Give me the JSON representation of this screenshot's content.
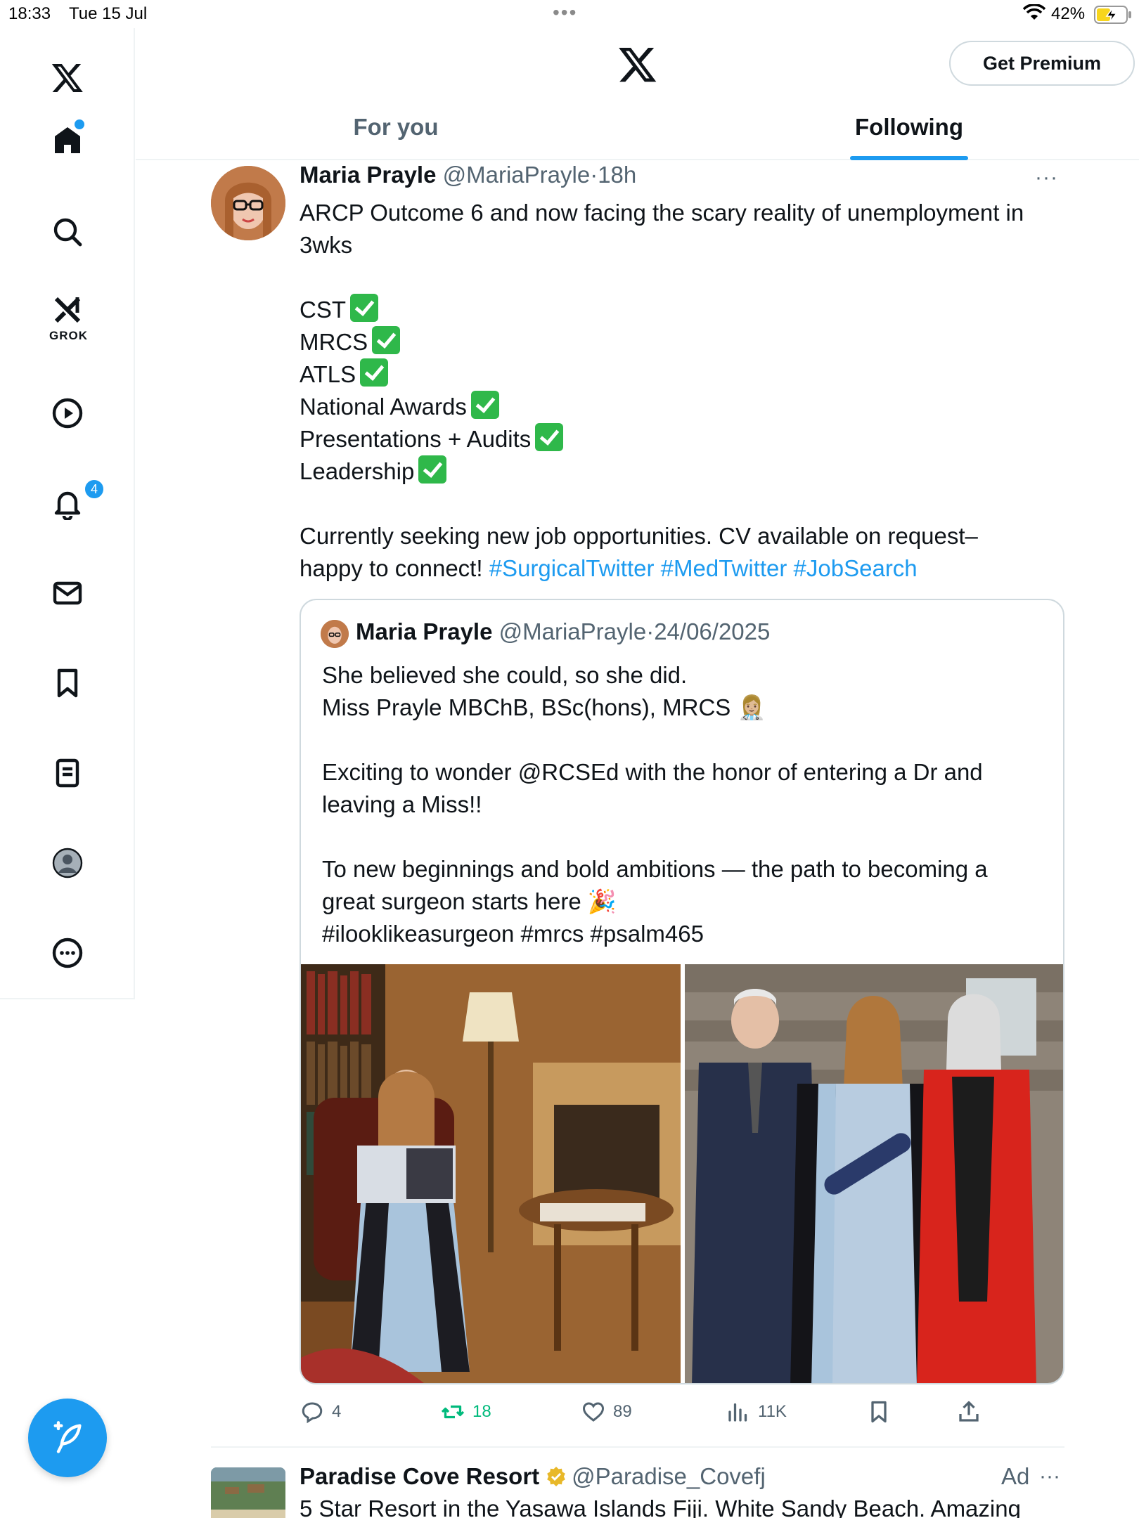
{
  "status_bar": {
    "time": "18:33",
    "date": "Tue 15 Jul",
    "battery": "42%"
  },
  "sidebar": {
    "notifications_badge": "4",
    "grok_label": "GROK"
  },
  "header": {
    "premium_button": "Get Premium",
    "tabs": [
      {
        "label": "For you",
        "active": false
      },
      {
        "label": "Following",
        "active": true
      }
    ]
  },
  "tweet": {
    "name": "Maria Prayle",
    "handle": "@MariaPrayle",
    "separator": "·",
    "time": "18h",
    "more": "···",
    "lines": [
      "ARCP Outcome 6 and now facing the scary reality of unemployment in",
      "3wks"
    ],
    "checklist": [
      "CST",
      "MRCS",
      "ATLS",
      "National Awards",
      "Presentations + Audits",
      "Leadership"
    ],
    "closing_line_1": "Currently seeking new job opportunities. CV available on request–",
    "closing_line_2_text": "happy to connect! ",
    "hashtags": [
      "#SurgicalTwitter",
      "#MedTwitter",
      "#JobSearch"
    ]
  },
  "quoted_tweet": {
    "name": "Maria Prayle",
    "handle": "@MariaPrayle",
    "separator": "·",
    "date": "24/06/2025",
    "line_1": "She believed she could, so she did.",
    "line_2": "Miss Prayle MBChB, BSc(hons), MRCS 👩🏼‍⚕️",
    "line_3": "Exciting to wonder @RCSEd with the honor of entering a Dr and",
    "line_4": "leaving a Miss!!",
    "line_5": "To new beginnings and bold ambitions — the path to becoming a",
    "line_6": "great surgeon starts here 🎉",
    "line_7": "#ilooklikeasurgeon #mrcs #psalm465"
  },
  "actions": {
    "replies": "4",
    "reposts": "18",
    "likes": "89",
    "views": "11K"
  },
  "ad_tweet": {
    "name": "Paradise Cove Resort",
    "handle": "@Paradise_Covefj",
    "ad_label": "Ad",
    "more": "···",
    "text": "5 Star Resort in the Yasawa Islands Fiji. White Sandy Beach. Amazing"
  }
}
